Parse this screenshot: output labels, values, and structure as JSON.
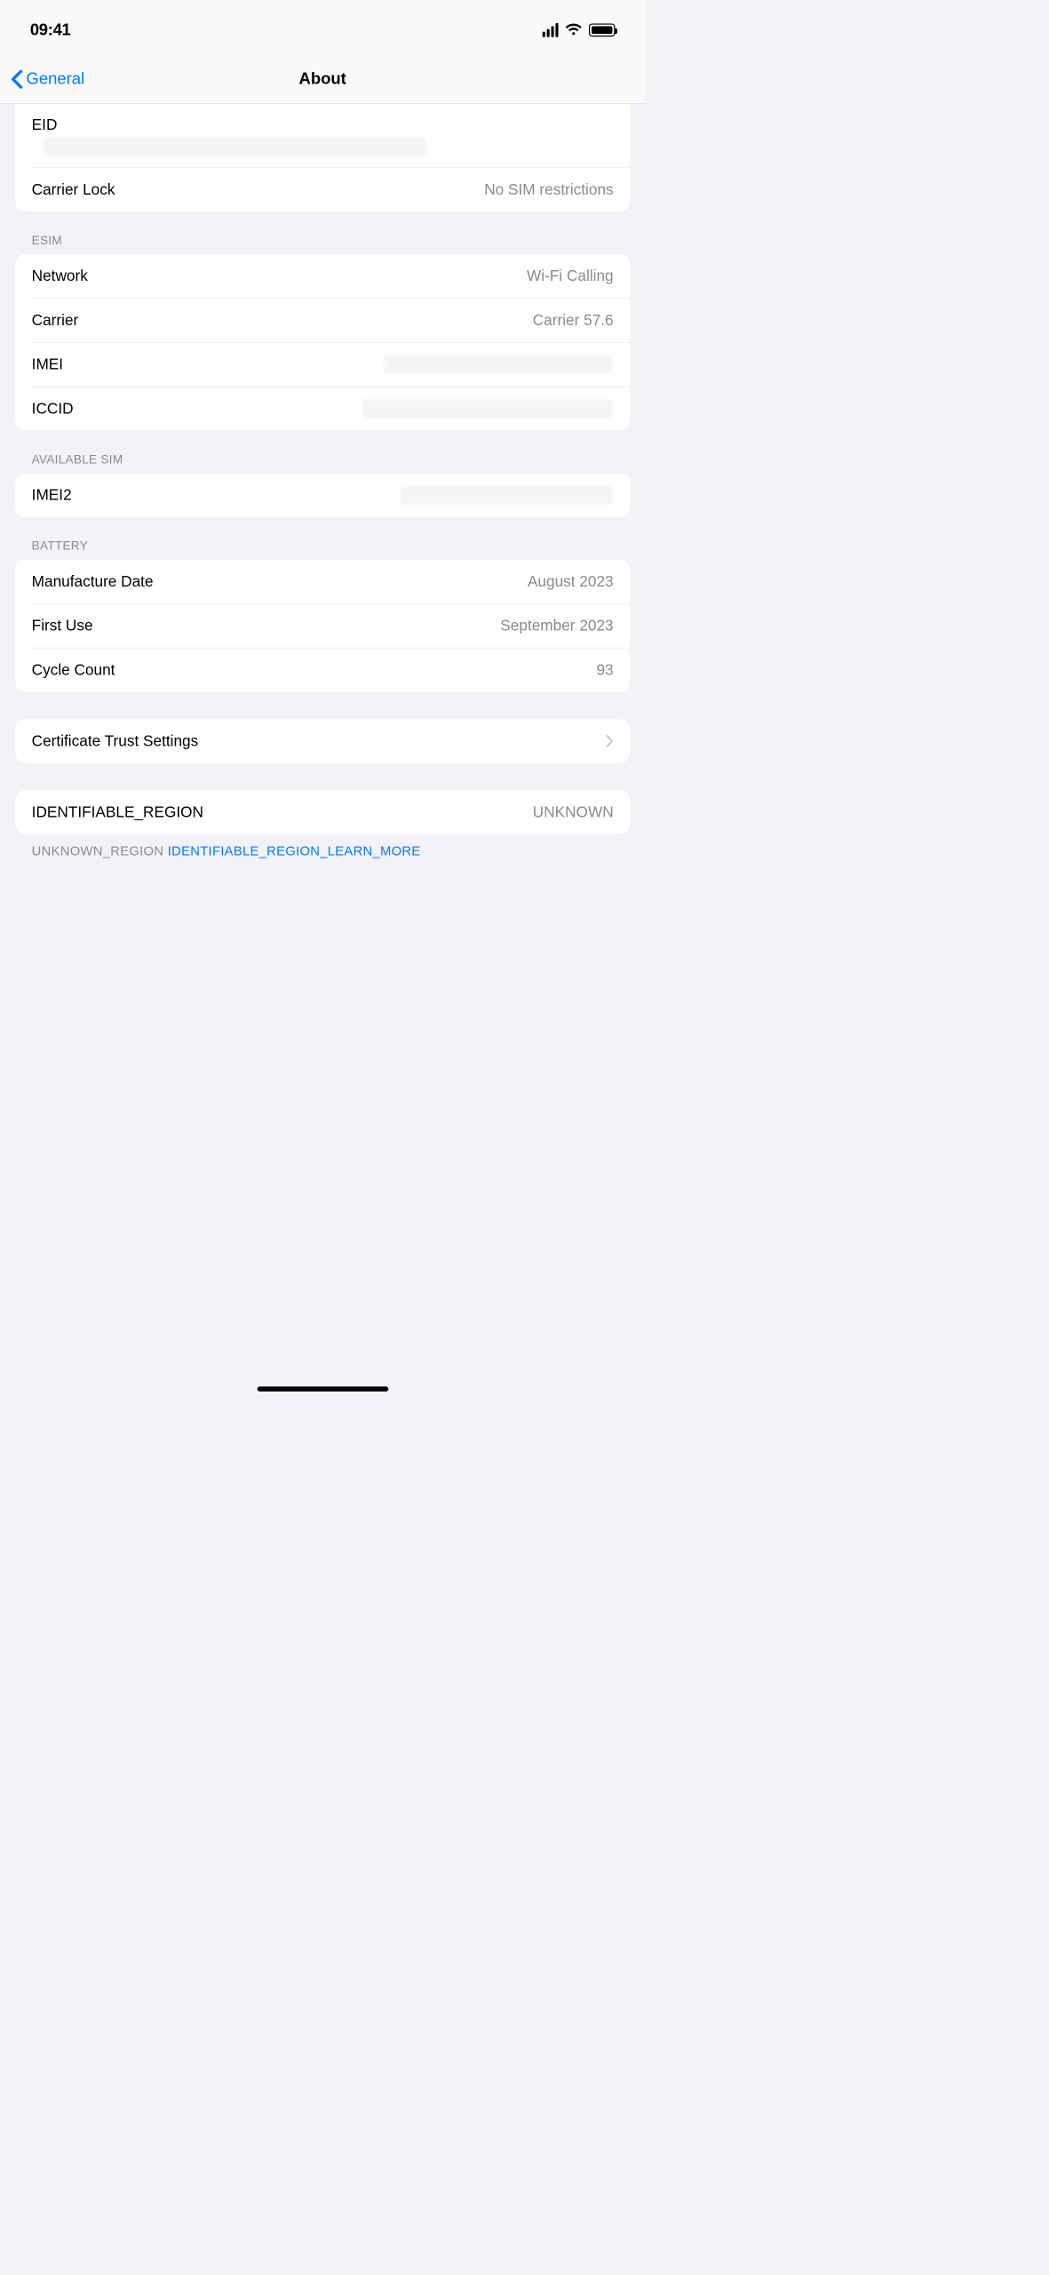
{
  "status": {
    "time": "09:41"
  },
  "nav": {
    "back": "General",
    "title": "About"
  },
  "top": {
    "eid_label": "EID",
    "carrier_lock_label": "Carrier Lock",
    "carrier_lock_value": "No SIM restrictions"
  },
  "esim": {
    "header": "ESIM",
    "network_label": "Network",
    "network_value": "Wi-Fi Calling",
    "carrier_label": "Carrier",
    "carrier_value": "Carrier 57.6",
    "imei_label": "IMEI",
    "iccid_label": "ICCID"
  },
  "available_sim": {
    "header": "AVAILABLE SIM",
    "imei2_label": "IMEI2"
  },
  "battery": {
    "header": "BATTERY",
    "manufacture_label": "Manufacture Date",
    "manufacture_value": "August 2023",
    "first_use_label": "First Use",
    "first_use_value": "September 2023",
    "cycle_label": "Cycle Count",
    "cycle_value": "93"
  },
  "cert": {
    "label": "Certificate Trust Settings"
  },
  "region": {
    "label": "IDENTIFIABLE_REGION",
    "value": "UNKNOWN",
    "footer_prefix": "UNKNOWN_REGION ",
    "footer_link": "IDENTIFIABLE_REGION_LEARN_MORE"
  }
}
